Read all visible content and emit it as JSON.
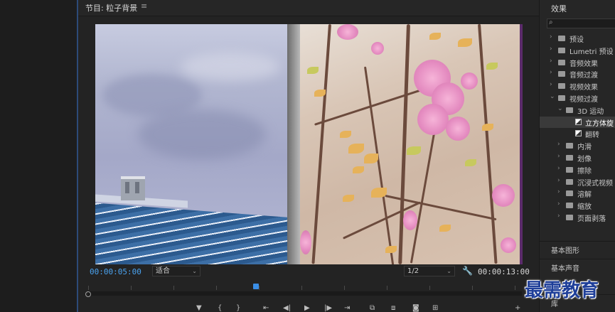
{
  "program_monitor": {
    "title": "节目: 粒子背景",
    "menu_icon": "hamburger-icon",
    "timecode_current": "00:00:05:00",
    "zoom_fit": "适合",
    "resolution": "1/2",
    "settings_icon": "wrench-icon",
    "timecode_duration": "00:00:13:00",
    "playhead_progress": 0.38,
    "transport_icons": [
      "add-marker-icon",
      "mark-in-icon",
      "mark-out-icon",
      "go-to-in-icon",
      "step-back-icon",
      "play-icon",
      "step-forward-icon",
      "go-to-out-icon",
      "insert-icon",
      "overwrite-icon",
      "export-frame-icon",
      "compare-icon",
      "add-button-icon"
    ]
  },
  "effects_panel": {
    "title": "效果",
    "search_placeholder": "",
    "items": [
      {
        "label": "预设",
        "level": 0,
        "expanded": false,
        "type": "folder-star"
      },
      {
        "label": "Lumetri 预设",
        "level": 0,
        "expanded": false,
        "type": "folder-star"
      },
      {
        "label": "音频效果",
        "level": 0,
        "expanded": false,
        "type": "folder"
      },
      {
        "label": "音频过渡",
        "level": 0,
        "expanded": false,
        "type": "folder"
      },
      {
        "label": "视频效果",
        "level": 0,
        "expanded": false,
        "type": "folder"
      },
      {
        "label": "视频过渡",
        "level": 0,
        "expanded": true,
        "type": "folder"
      },
      {
        "label": "3D 运动",
        "level": 1,
        "expanded": true,
        "type": "folder"
      },
      {
        "label": "立方体旋",
        "level": 2,
        "selected": true,
        "type": "effect"
      },
      {
        "label": "翻转",
        "level": 2,
        "type": "effect"
      },
      {
        "label": "内滑",
        "level": 1,
        "expanded": false,
        "type": "folder"
      },
      {
        "label": "划像",
        "level": 1,
        "expanded": false,
        "type": "folder"
      },
      {
        "label": "擦除",
        "level": 1,
        "expanded": false,
        "type": "folder"
      },
      {
        "label": "沉浸式视频",
        "level": 1,
        "expanded": false,
        "type": "folder"
      },
      {
        "label": "溶解",
        "level": 1,
        "expanded": false,
        "type": "folder"
      },
      {
        "label": "缩放",
        "level": 1,
        "expanded": false,
        "type": "folder"
      },
      {
        "label": "页面剥落",
        "level": 1,
        "expanded": false,
        "type": "folder"
      }
    ],
    "sections": [
      "基本图形",
      "基本声音",
      "库"
    ]
  },
  "watermark": "最需教育",
  "colors": {
    "accent": "#4aa3f0",
    "background": "#232323",
    "selection": "#3a3a3a"
  }
}
